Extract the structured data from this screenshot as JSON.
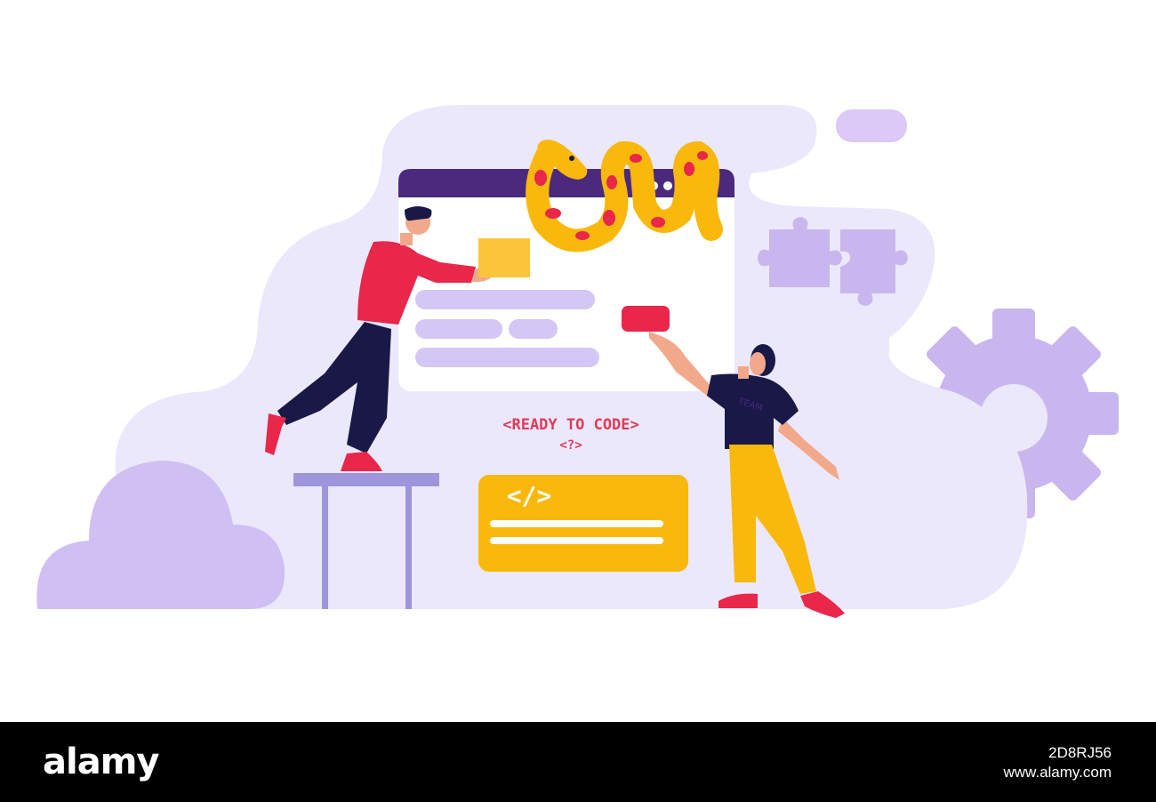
{
  "illustration": {
    "headline": "<READY TO CODE>",
    "subline": "<?>",
    "code_icon": "</>",
    "shirt_text": "TEAM",
    "colors": {
      "lavender_bg": "#ebe8fb",
      "purple_light": "#d4c6f5",
      "purple_mid": "#c3b3ef",
      "browser_bar": "#4b2a7d",
      "yellow": "#f9b80c",
      "red": "#e8274b",
      "navy": "#1a1847",
      "skin": "#f2a98b"
    },
    "icons": [
      "cloud-icon",
      "gear-icon",
      "puzzle-icon",
      "snake-icon",
      "code-icon"
    ]
  },
  "watermark": {
    "brand": "alamy",
    "image_id": "2D8RJ56",
    "url": "www.alamy.com"
  }
}
